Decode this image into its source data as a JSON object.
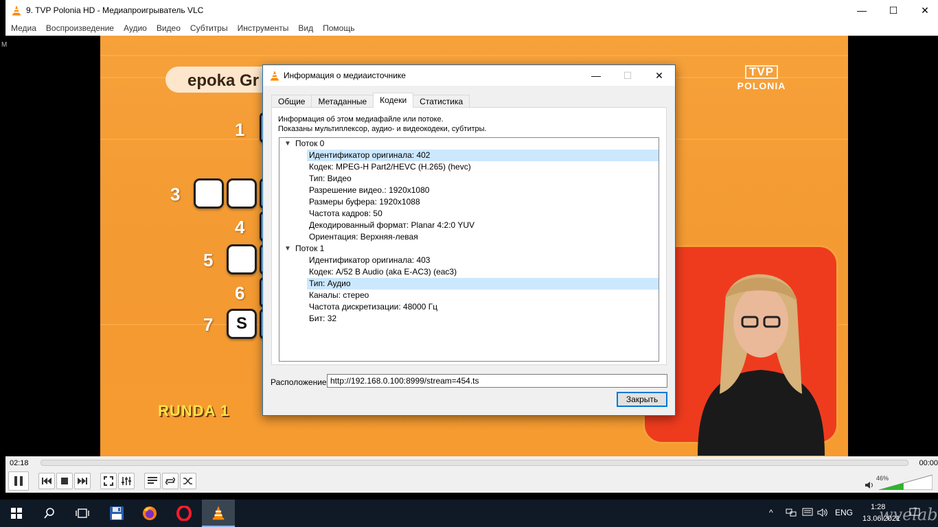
{
  "window": {
    "title": "9. TVP Polonia HD - Медиапроигрыватель VLC",
    "minimize_glyph": "—",
    "maximize_glyph": "☐",
    "close_glyph": "✕"
  },
  "menu": [
    "Медиа",
    "Воспроизведение",
    "Аудио",
    "Видео",
    "Субтитры",
    "Инструменты",
    "Вид",
    "Помощь"
  ],
  "video": {
    "word_pill": "epoka Gr",
    "channel_logo_top": "TVP",
    "channel_logo_bottom": "POLONIA",
    "row_numbers": [
      "1",
      "3",
      "4",
      "5",
      "6",
      "7"
    ],
    "tile_letter": "S",
    "round_label": "RUNDA 1"
  },
  "dialog": {
    "title": "Информация о медиаисточнике",
    "tabs": [
      {
        "label": "Общие",
        "active": false
      },
      {
        "label": "Метаданные",
        "active": false
      },
      {
        "label": "Кодеки",
        "active": true
      },
      {
        "label": "Статистика",
        "active": false
      }
    ],
    "description_line1": "Информация об этом медиафайле или потоке.",
    "description_line2": "Показаны мультиплексор, аудио- и видеокодеки, субтитры.",
    "streams": [
      {
        "label": "Поток 0",
        "items": [
          {
            "text": "Идентификатор оригинала: 402",
            "selected": true
          },
          {
            "text": "Кодек: MPEG-H Part2/HEVC (H.265) (hevc)",
            "selected": false
          },
          {
            "text": "Тип: Видео",
            "selected": false
          },
          {
            "text": "Разрешение видео.: 1920x1080",
            "selected": false
          },
          {
            "text": "Размеры буфера: 1920x1088",
            "selected": false
          },
          {
            "text": "Частота кадров: 50",
            "selected": false
          },
          {
            "text": "Декодированный формат: Planar 4:2:0 YUV",
            "selected": false
          },
          {
            "text": "Ориентация: Верхняя-левая",
            "selected": false
          }
        ]
      },
      {
        "label": "Поток 1",
        "items": [
          {
            "text": "Идентификатор оригинала: 403",
            "selected": false
          },
          {
            "text": "Кодек: A/52 B Audio (aka E-AC3) (eac3)",
            "selected": false
          },
          {
            "text": "Тип: Аудио",
            "selected": true
          },
          {
            "text": "Каналы: стерео",
            "selected": false
          },
          {
            "text": "Частота дискретизации: 48000 Гц",
            "selected": false
          },
          {
            "text": "Бит: 32",
            "selected": false
          }
        ]
      }
    ],
    "location_label": "Расположение:",
    "location_value": "http://192.168.0.100:8999/stream=454.ts",
    "close_button": "Закрыть"
  },
  "controls": {
    "time_current": "02:18",
    "time_total": "00:00",
    "volume_percent": "46%",
    "volume_level": 0.46
  },
  "taskbar": {
    "language": "ENG",
    "clock_time": "1:28",
    "clock_date": "13.06.2021"
  },
  "watermark": "wvelab.net",
  "colors": {
    "accent": "#0078d7",
    "selection": "#cce8ff",
    "volume_fill": "#2db52d",
    "taskbar": "#101a26"
  }
}
